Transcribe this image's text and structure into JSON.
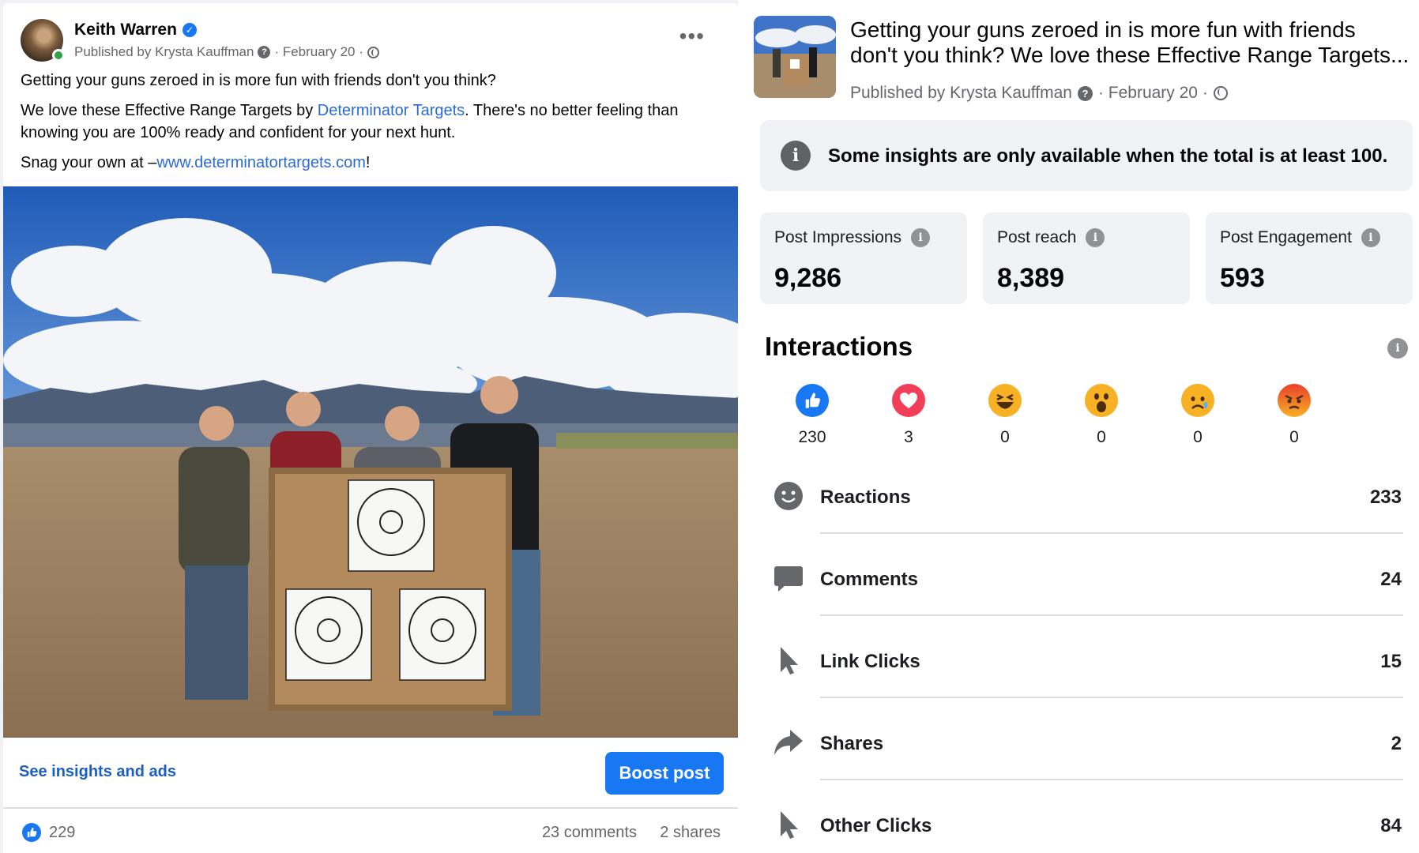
{
  "post": {
    "author": "Keith Warren",
    "published_by": "Published by Krysta Kauffman",
    "date": "· February 20 ·",
    "paragraph1": "Getting your guns zeroed in is more fun with friends don't you think?",
    "paragraph2_pre": "We love these Effective Range Targets by ",
    "paragraph2_link": "Determinator Targets",
    "paragraph2_post": ". There's no better feeling than knowing you are 100% ready and confident for your next hunt.",
    "paragraph3_pre": "Snag your own at –",
    "paragraph3_link": "www.determinatortargets.com",
    "paragraph3_post": "!",
    "insights_link": "See insights and ads",
    "boost_label": "Boost post",
    "likes": "229",
    "comments": "23 comments",
    "shares": "2 shares"
  },
  "panel": {
    "title_line1": "Getting your guns zeroed in is more fun with friends",
    "title_line2": "don't you think? We love these Effective Range Targets...",
    "published_by": "Published by Krysta Kauffman",
    "date": "· February 20 ·",
    "notice": "Some insights are only available when the total is at least 100.",
    "metrics": [
      {
        "label": "Post Impressions",
        "value": "9,286"
      },
      {
        "label": "Post reach",
        "value": "8,389"
      },
      {
        "label": "Post Engagement",
        "value": "593"
      }
    ],
    "interactions_title": "Interactions",
    "reactions": [
      {
        "icon": "like-icon",
        "count": "230",
        "color": "#1877f2"
      },
      {
        "icon": "love-icon",
        "count": "3",
        "color": "#f33e58"
      },
      {
        "icon": "haha-icon",
        "count": "0",
        "color": "#f7b125"
      },
      {
        "icon": "wow-icon",
        "count": "0",
        "color": "#f7b125"
      },
      {
        "icon": "sad-icon",
        "count": "0",
        "color": "#f7b125"
      },
      {
        "icon": "angry-icon",
        "count": "0",
        "color": "#e9710f"
      }
    ],
    "rows": [
      {
        "icon": "smiley-icon",
        "label": "Reactions",
        "value": "233"
      },
      {
        "icon": "comment-bubble-icon",
        "label": "Comments",
        "value": "24"
      },
      {
        "icon": "cursor-icon",
        "label": "Link Clicks",
        "value": "15"
      },
      {
        "icon": "share-arrow-icon",
        "label": "Shares",
        "value": "2"
      },
      {
        "icon": "cursor-icon",
        "label": "Other Clicks",
        "value": "84"
      }
    ]
  }
}
